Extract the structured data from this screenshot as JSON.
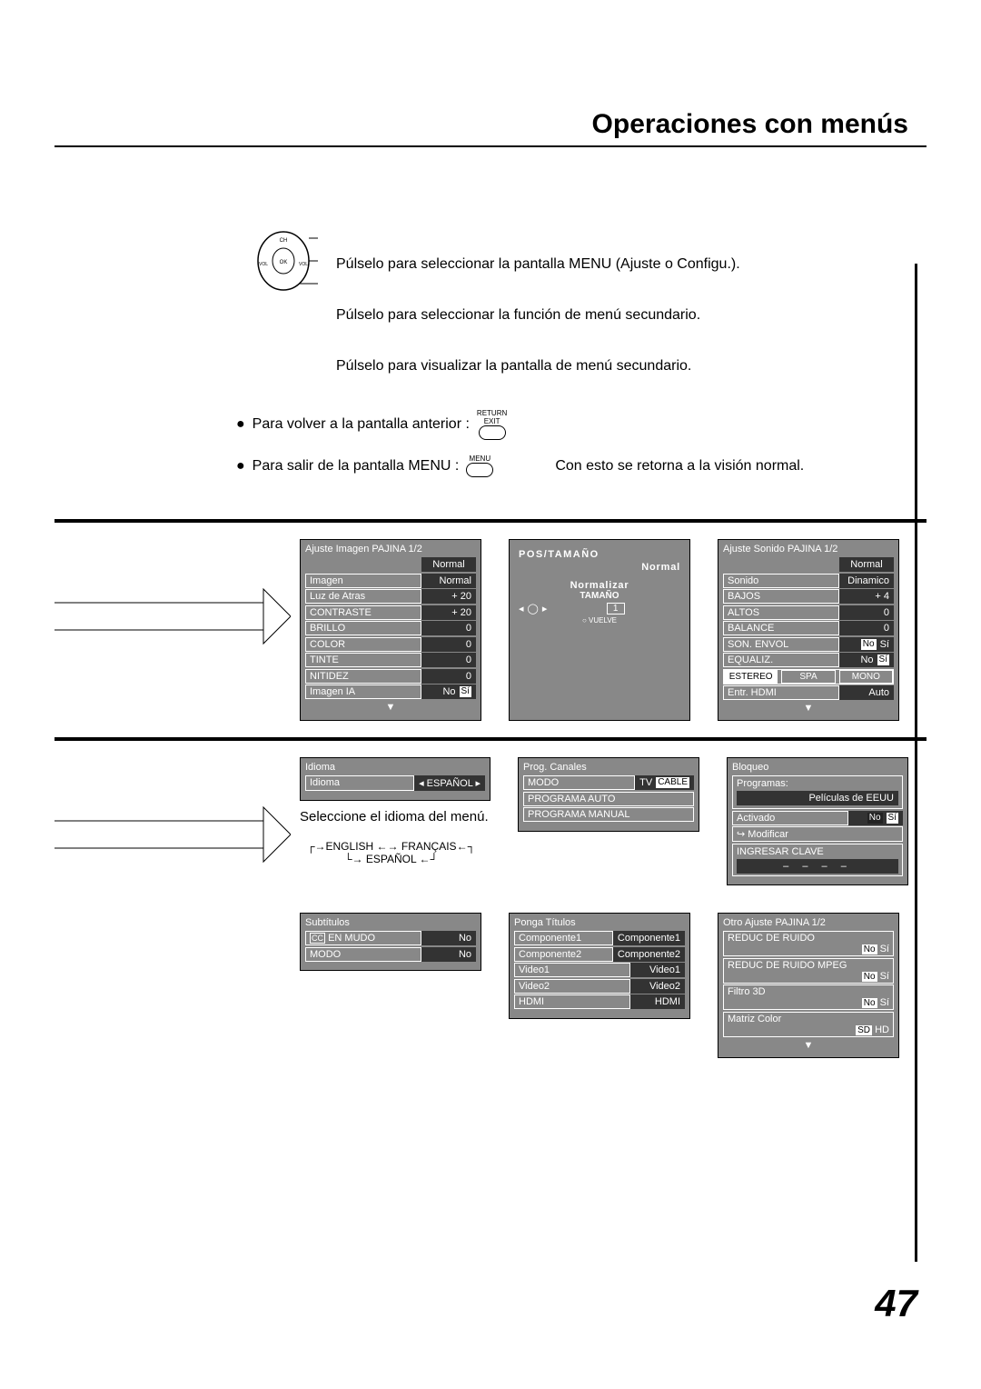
{
  "title": "Operaciones con menús",
  "page_number": "47",
  "instructions": {
    "line1": "Púlselo para seleccionar la pantalla MENU (Ajuste o Configu.).",
    "line2": "Púlselo para seleccionar la función de menú secundario.",
    "line3": "Púlselo para visualizar la pantalla de menú secundario.",
    "bullet1": "Para volver a la pantalla anterior :",
    "bullet2": "Para salir de la pantalla MENU :",
    "return_label": "RETURN",
    "exit_label": "EXIT",
    "menu_label": "MENU",
    "normal_vision": "Con esto se retorna a la visión normal."
  },
  "remote": {
    "ch": "CH",
    "ok": "OK",
    "vol_l": "VOL",
    "vol_r": "VOL"
  },
  "ajuste_imagen": {
    "header": "Ajuste  Imagen   PAJINA  1/2",
    "rows": [
      {
        "val_only": true,
        "val": "Normal"
      },
      {
        "lbl": "Imagen",
        "val": "Normal"
      },
      {
        "lbl": "Luz de Atras",
        "val": "+ 20"
      },
      {
        "lbl": "CONTRASTE",
        "val": "+ 20"
      },
      {
        "lbl": "BRILLO",
        "val": "0"
      },
      {
        "lbl": "COLOR",
        "val": "0"
      },
      {
        "lbl": "TINTE",
        "val": "0"
      },
      {
        "lbl": "NITIDEZ",
        "val": "0"
      },
      {
        "lbl": "Imagen IA",
        "no": "No",
        "si": "Sí"
      }
    ]
  },
  "pos_tamano": {
    "title": "POS/TAMAÑO",
    "normal": "Normal",
    "normalizar": "Normalizar",
    "tamano": "TAMAÑO",
    "num": "1",
    "vuelve": "VUELVE"
  },
  "ajuste_sonido": {
    "header": "Ajuste  Sonido   PAJINA  1/2",
    "rows": [
      {
        "val_only": true,
        "val": "Normal"
      },
      {
        "lbl": "Sonido",
        "val": "Dinamico"
      },
      {
        "lbl": "BAJOS",
        "val": "+   4"
      },
      {
        "lbl": "ALTOS",
        "val": "0"
      },
      {
        "lbl": "BALANCE",
        "val": "0"
      },
      {
        "lbl": "SON. ENVOL",
        "no": "No",
        "si": "Sí"
      },
      {
        "lbl": "EQUALIZ.",
        "no": "No",
        "si": "Sí"
      }
    ],
    "mode_row": {
      "a": "ESTEREO",
      "b": "SPA",
      "c": "MONO"
    },
    "hdmi": {
      "lbl": "Entr. HDMI",
      "val": "Auto"
    }
  },
  "idioma": {
    "header": "Idioma",
    "lbl": "Idioma",
    "val": "ESPAÑOL",
    "caption": "Seleccione el idioma del menú.",
    "cycle": {
      "en": "ENGLISH",
      "fr": "FRANÇAIS",
      "es": "ESPAÑOL"
    }
  },
  "prog_canales": {
    "header": "Prog. Canales",
    "rows": [
      {
        "lbl": "MODO",
        "tv": "TV",
        "cable": "CABLE"
      },
      {
        "full": "PROGRAMA  AUTO"
      },
      {
        "full": "PROGRAMA  MANUAL"
      }
    ]
  },
  "bloqueo": {
    "header": "Bloqueo",
    "programas": "Programas:",
    "pel": "Películas de EEUU",
    "activado_lbl": "Activado",
    "no": "No",
    "si": "Sí",
    "modificar": "Modificar",
    "clave": "INGRESAR CLAVE",
    "dashes": "– – – –"
  },
  "subtitulos": {
    "header": "Subtítulos",
    "rows": [
      {
        "cc": "CC",
        "lbl": "EN MUDO",
        "val": "No"
      },
      {
        "lbl": "MODO",
        "val": "No"
      }
    ]
  },
  "ponga_titulos": {
    "header": "Ponga Títulos",
    "rows": [
      {
        "a": "Componente1",
        "b": "Componente1"
      },
      {
        "a": "Componente2",
        "b": "Componente2"
      },
      {
        "a": "Video1",
        "b": "Video1"
      },
      {
        "a": "Video2",
        "b": "Video2"
      },
      {
        "a": "HDMI",
        "b": "HDMI"
      }
    ]
  },
  "otro_ajuste": {
    "header": "Otro  Ajuste      PAJINA     1/2",
    "rows": [
      {
        "line": "REDUC DE RUIDO",
        "no": "No",
        "si": "Sí"
      },
      {
        "line": "REDUC DE RUIDO MPEG",
        "no": "No",
        "si": "Sí"
      },
      {
        "line": "Filtro 3D",
        "no": "No",
        "si": "Sí"
      },
      {
        "line": "Matriz Color",
        "sd": "SD",
        "hd": "HD"
      }
    ]
  }
}
